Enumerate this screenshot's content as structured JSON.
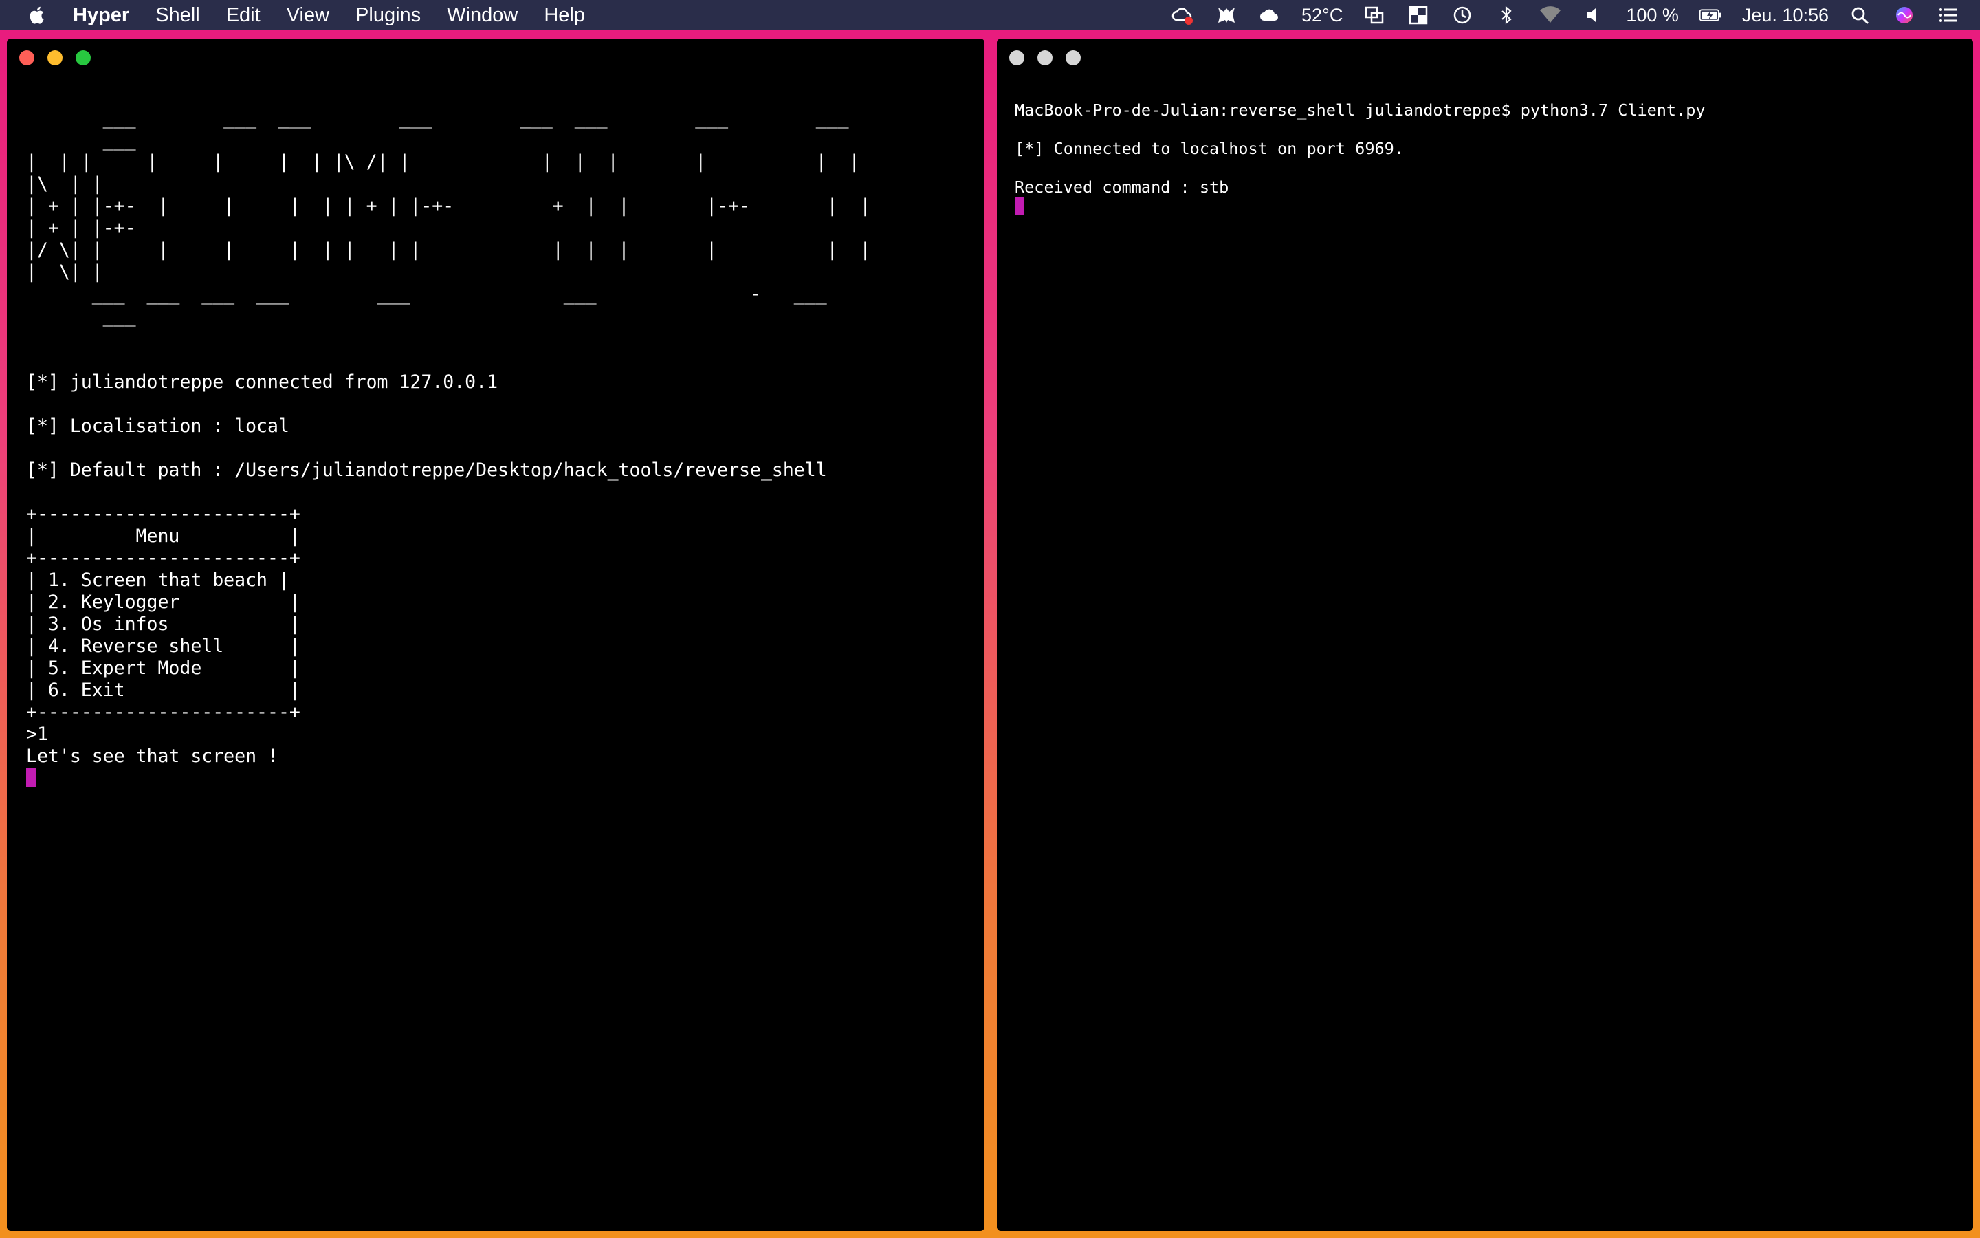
{
  "menubar": {
    "app_name": "Hyper",
    "menus": [
      "Shell",
      "Edit",
      "View",
      "Plugins",
      "Window",
      "Help"
    ],
    "temperature": "52°C",
    "battery": "100 %",
    "clock": "Jeu. 10:56",
    "icons": [
      "apple-logo-icon",
      "creative-cloud-icon",
      "dragon-app-icon",
      "weather-cloud-icon",
      "screen-capture-icon",
      "window-manager-icon",
      "time-machine-icon",
      "bluetooth-icon",
      "wifi-icon",
      "volume-icon",
      "battery-charging-icon",
      "search-icon",
      "siri-icon",
      "control-center-icon"
    ]
  },
  "left_terminal": {
    "banner": [
      "       ___        ___  ___        ___        ___  ___        ___        ___",
      "       ___",
      "|  | |     |     |     |  | |\\ /| |            |  |  |       |          |  |",
      "|\\  | |",
      "| + | |-+-  |     |     |  | | + | |-+-         +  |  |       |-+-       |  |",
      "| + | |-+-",
      "|/ \\| |     |     |     |  | |   | |            |  |  |       |          |  |",
      "|  \\| |",
      "      ___  ___  ___  ___        ___              ___              -   ___",
      "       ___"
    ],
    "connected": "[*] juliandotreppe connected from 127.0.0.1",
    "localisation": "[*] Localisation : local",
    "default_path": "[*] Default path : /Users/juliandotreppe/Desktop/hack_tools/reverse_shell",
    "menu_border": "+-----------------------+",
    "menu_title": "|         Menu          |",
    "menu_items": [
      "| 1. Screen that beach |",
      "| 2. Keylogger          |",
      "| 3. Os infos           |",
      "| 4. Reverse shell      |",
      "| 5. Expert Mode        |",
      "| 6. Exit               |"
    ],
    "prompt_input": ">1",
    "response": "Let's see that screen !"
  },
  "right_terminal": {
    "command_line": "MacBook-Pro-de-Julian:reverse_shell juliandotreppe$ python3.7 Client.py",
    "connected": "[*] Connected to localhost on port 6969.",
    "received": "Received command : stb"
  },
  "colors": {
    "frame_top": "#e8197e",
    "frame_bottom": "#f2901e",
    "cursor": "#c21cb2",
    "menubar": "#2a2d4a"
  }
}
